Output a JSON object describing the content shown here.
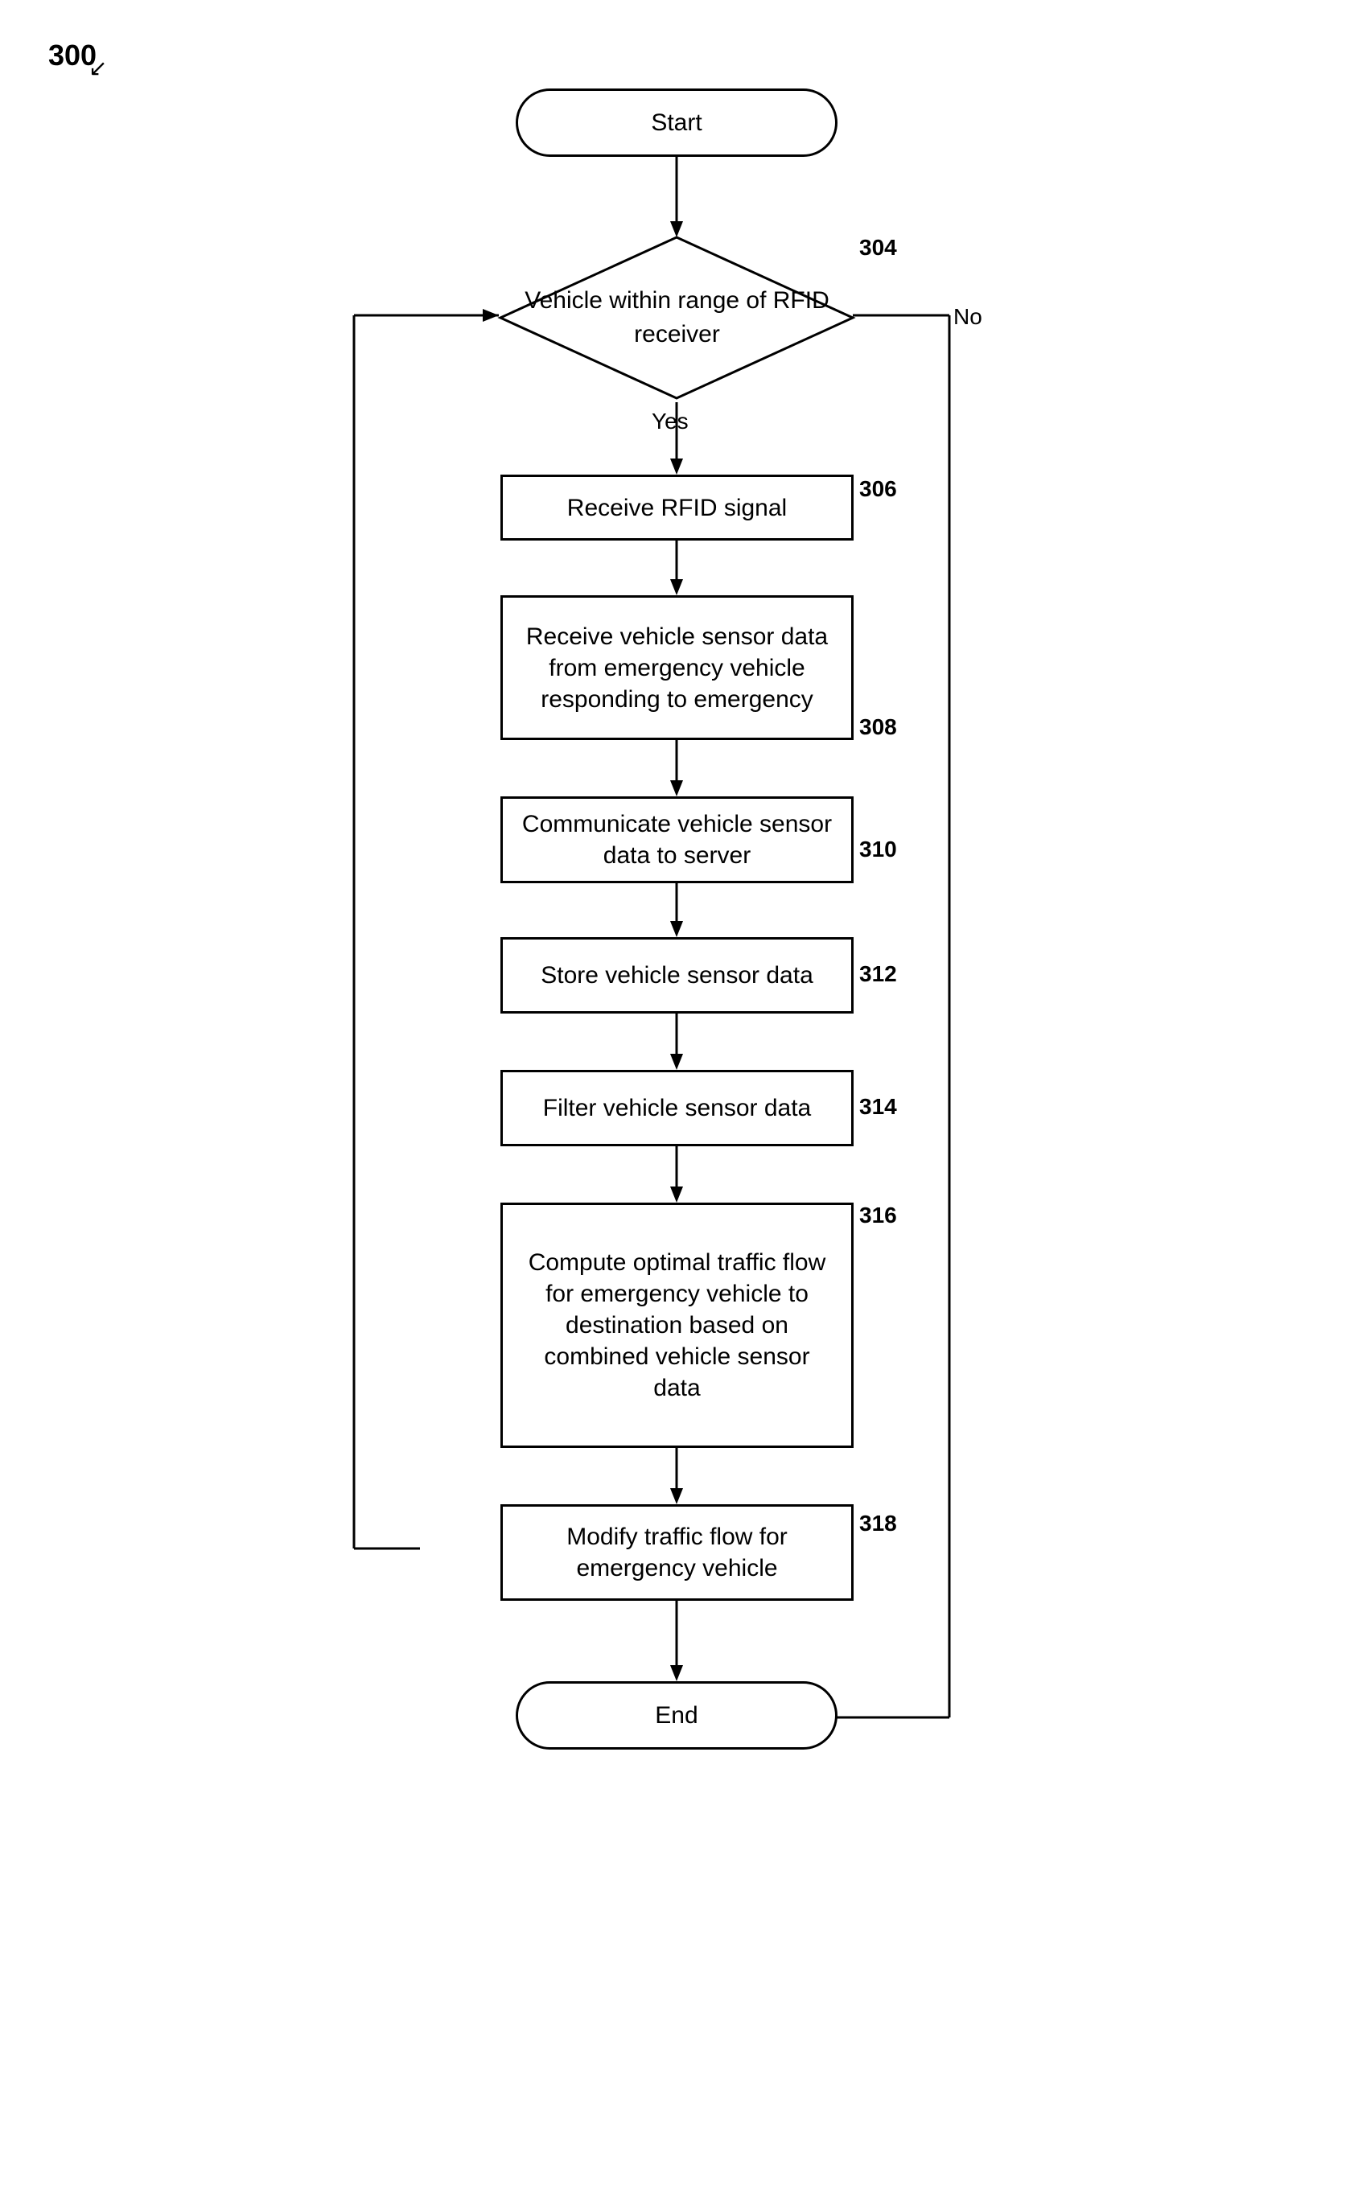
{
  "figure": {
    "label": "300",
    "arrow": "↙"
  },
  "nodes": {
    "start": {
      "label": "Start"
    },
    "decision": {
      "label": "Vehicle\nwithin range of\nRFID receiver"
    },
    "step306": {
      "label": "Receive RFID signal"
    },
    "step308": {
      "label": "Receive vehicle sensor data\nfrom emergency vehicle\nresponding to emergency"
    },
    "step310": {
      "label": "Communicate vehicle sensor\ndata to server"
    },
    "step312": {
      "label": "Store vehicle sensor data"
    },
    "step314": {
      "label": "Filter vehicle sensor data"
    },
    "step316": {
      "label": "Compute optimal traffic flow\nfor emergency vehicle to\ndestination based on\ncombined vehicle sensor\ndata"
    },
    "step318": {
      "label": "Modify traffic flow for\nemergency vehicle"
    },
    "end": {
      "label": "End"
    }
  },
  "step_numbers": {
    "s304": "304",
    "s306": "306",
    "s308": "308",
    "s310": "310",
    "s312": "312",
    "s314": "314",
    "s316": "316",
    "s318": "318"
  },
  "flow_labels": {
    "yes": "Yes",
    "no": "No"
  }
}
